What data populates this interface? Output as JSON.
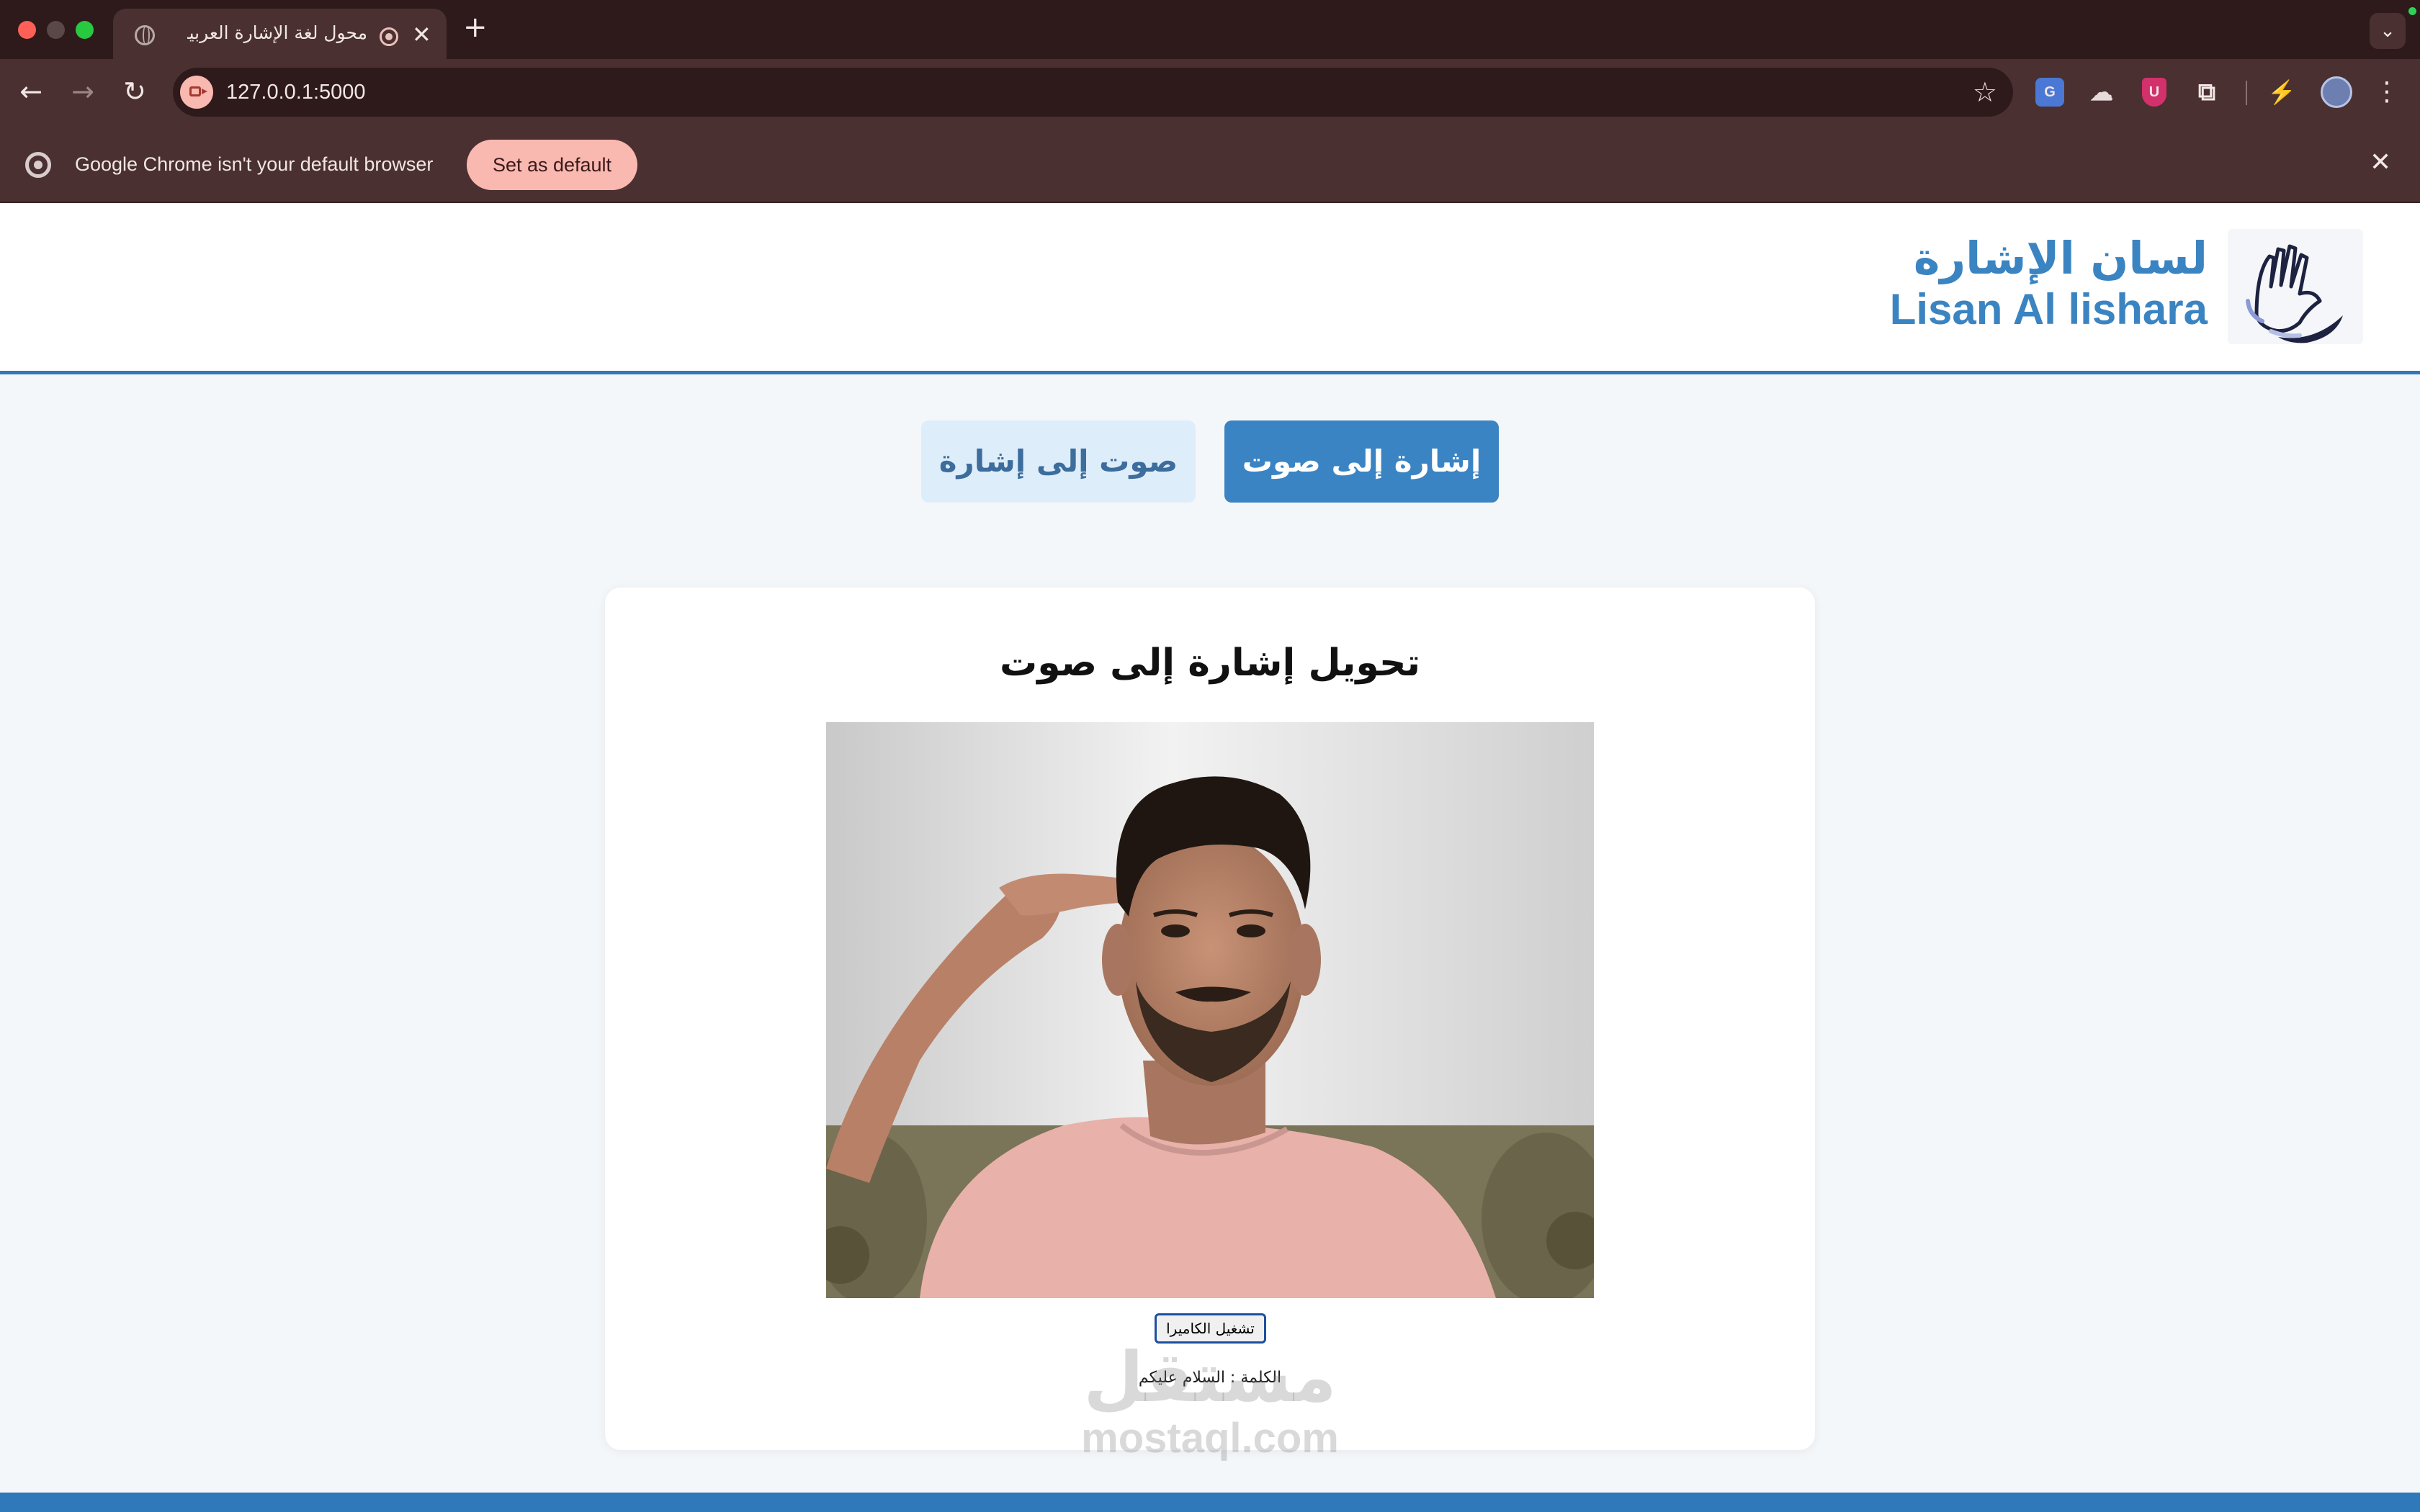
{
  "browser": {
    "tab": {
      "title": "محول لغة الإشارة العربية",
      "close_glyph": "✕"
    },
    "new_tab_glyph": "+",
    "address": "127.0.0.1:5000",
    "icons": [
      "back-icon",
      "forward-icon",
      "reload-icon",
      "camera-in-use-icon",
      "star-icon",
      "translate-extension-icon",
      "cloud-extension-icon",
      "shield-extension-icon",
      "puzzle-icon",
      "performance-icon",
      "profile-avatar",
      "more-menu-icon"
    ],
    "infobar": {
      "message": "Google Chrome isn't your default browser",
      "button": "Set as default",
      "close_glyph": "✕"
    }
  },
  "header": {
    "logo_ar": "لسان الإشارة",
    "logo_en": "Lisan Al lishara"
  },
  "modes": {
    "sign_to_voice": "إشارة إلى صوت",
    "voice_to_sign": "صوت إلى إشارة"
  },
  "card": {
    "title": "تحويل إشارة إلى صوت",
    "camera_button": "تشغيل الكاميرا",
    "word_label": "الكلمة : السلام عليكم"
  },
  "watermark": {
    "ar": "مستقل",
    "en": "mostaql.com"
  },
  "colors": {
    "primary": "#3a84c4",
    "primary_light": "#deedfa",
    "chrome_dark": "#2e1a1a",
    "chrome_mid": "#4a3030",
    "chrome_accent": "#f9b8b0"
  }
}
